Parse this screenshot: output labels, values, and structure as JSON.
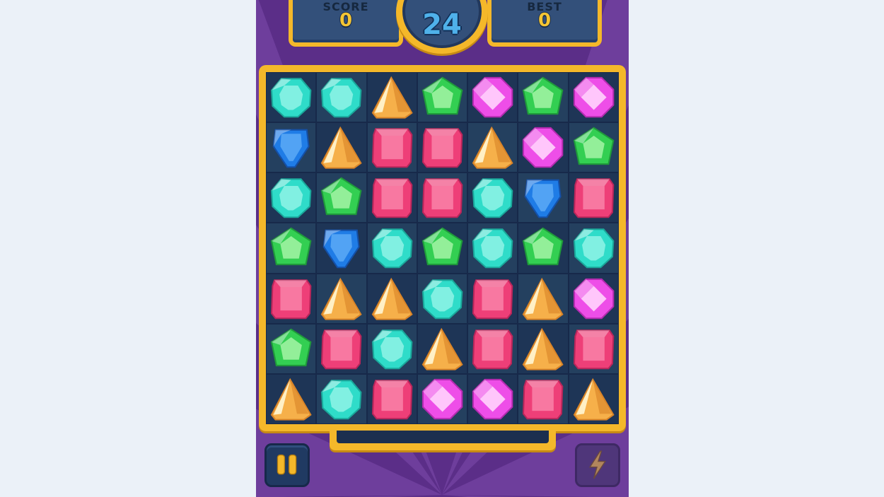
{
  "hud": {
    "score_label": "SCORE",
    "score_value": "0",
    "best_label": "BEST",
    "best_value": "0",
    "timer_value": "24"
  },
  "progress": {
    "fill_fraction": 0.0
  },
  "buttons": {
    "pause_icon": "pause-icon",
    "boost_icon": "lightning-bolt-icon",
    "boost_enabled": false
  },
  "board": {
    "rows": 7,
    "cols": 7,
    "grid": [
      [
        "cyan",
        "cyan",
        "orange",
        "green",
        "pink",
        "green",
        "pink"
      ],
      [
        "blue",
        "orange",
        "red",
        "red",
        "orange",
        "pink",
        "green"
      ],
      [
        "cyan",
        "green",
        "red",
        "red",
        "cyan",
        "blue",
        "red"
      ],
      [
        "green",
        "blue",
        "cyan",
        "green",
        "cyan",
        "green",
        "cyan"
      ],
      [
        "red",
        "orange",
        "orange",
        "cyan",
        "red",
        "orange",
        "pink"
      ],
      [
        "green",
        "red",
        "cyan",
        "orange",
        "red",
        "orange",
        "red"
      ],
      [
        "orange",
        "cyan",
        "red",
        "pink",
        "pink",
        "red",
        "orange"
      ]
    ]
  },
  "gem_colors": {
    "cyan": {
      "base": "#2fdcc9",
      "light": "#9ef7ea",
      "dark": "#1aa79a"
    },
    "orange": {
      "base": "#f6b04a",
      "light": "#fff0c6",
      "dark": "#d98428"
    },
    "green": {
      "base": "#33cf52",
      "light": "#a4f5a6",
      "dark": "#1f9a3a"
    },
    "pink": {
      "base": "#ee4ee8",
      "light": "#ffc6fb",
      "dark": "#b42bb0"
    },
    "blue": {
      "base": "#1f7ce6",
      "light": "#7cc2ff",
      "dark": "#1450a8"
    },
    "red": {
      "base": "#ee3f78",
      "light": "#ff9ebd",
      "dark": "#b8265a"
    }
  },
  "theme": {
    "background_purple": "#5b2e88",
    "ray_purple": "#6e3e9c",
    "frame_gold": "#f4b82a",
    "panel_navy": "#33507a"
  }
}
